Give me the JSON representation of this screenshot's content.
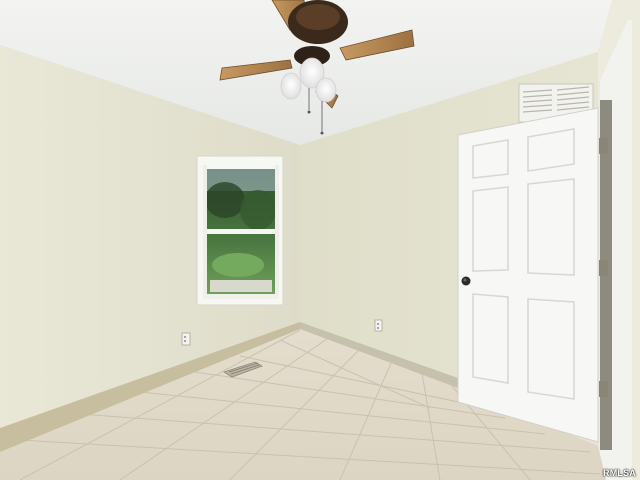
{
  "scene": {
    "description_label": "",
    "colors": {
      "ceiling": "#eef0ee",
      "left_wall": "#e7e5d4",
      "back_wall": "#e2e1cd",
      "door": "#f6f6f4",
      "trim": "#c9c2ac",
      "floor_light": "#ece5d6",
      "floor_grout": "#cfc6b3",
      "fan_blade": "#b08552",
      "fan_body": "#3a2a1c",
      "foliage": "#3f6a3a",
      "sky": "#cfdde6"
    },
    "icons": {
      "ceiling_fan": "ceiling-fan-icon",
      "air_vent": "air-vent-icon",
      "floor_vent": "floor-vent-icon",
      "outlet": "power-outlet-icon",
      "door_knob": "door-knob-icon"
    }
  },
  "watermark": {
    "text": "RMLSA"
  }
}
